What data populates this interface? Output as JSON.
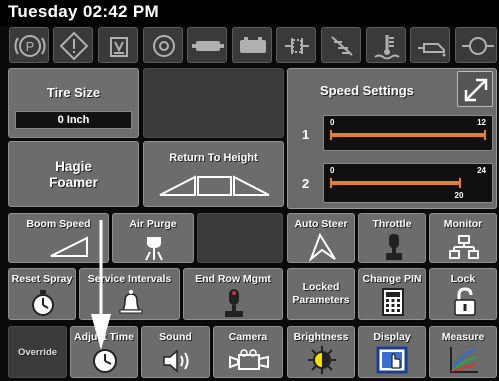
{
  "status": {
    "datetime": "Tuesday 02:42 PM"
  },
  "warnings": [
    {
      "icon": "parking-brake-icon"
    },
    {
      "icon": "diamond-warning-icon"
    },
    {
      "icon": "tank-level-icon"
    },
    {
      "icon": "engine-icon"
    },
    {
      "icon": "filter-icon"
    },
    {
      "icon": "battery-icon"
    },
    {
      "icon": "fuel-pump-icon"
    },
    {
      "icon": "spray-off-icon"
    },
    {
      "icon": "coolant-temp-icon"
    },
    {
      "icon": "oil-pressure-icon"
    },
    {
      "icon": "hydraulic-icon"
    }
  ],
  "tire_size": {
    "label": "Tire Size",
    "value": "0 Inch"
  },
  "hagie_foamer": {
    "label": "Hagie Foamer"
  },
  "return_to_height": {
    "label": "Return To Height"
  },
  "speed_settings": {
    "title": "Speed Settings",
    "accent": "#e27f34",
    "rows": [
      {
        "index": "1",
        "min": "0",
        "max": "12",
        "value": 12
      },
      {
        "index": "2",
        "min": "0",
        "max": "24",
        "value_label": "20",
        "value": 20
      }
    ]
  },
  "buttons": {
    "boom_speed": "Boom Speed",
    "air_purge": "Air Purge",
    "auto_steer": "Auto Steer",
    "throttle": "Throttle",
    "monitor": "Monitor",
    "reset_spray": "Reset Spray",
    "service_intervals": "Service Intervals",
    "end_row_mgmt": "End Row Mgmt",
    "locked_parameters": "Locked Parameters",
    "change_pin": "Change PIN",
    "lock": "Lock",
    "override": "Override",
    "adjust_time": "Adjust Time",
    "sound": "Sound",
    "camera": "Camera",
    "brightness": "Brightness",
    "display": "Display",
    "measure": "Measure"
  }
}
